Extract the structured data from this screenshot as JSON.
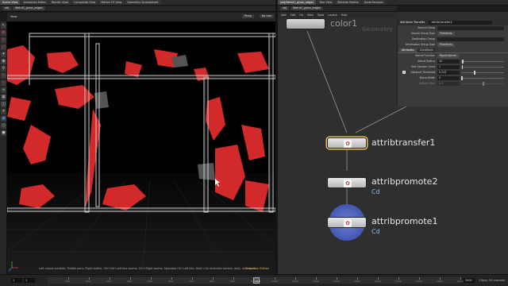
{
  "left_tabs": [
    "Scene View",
    "Animation Editor",
    "Render View",
    "Composite View",
    "Motion FX View",
    "Geometry Spreadsheet"
  ],
  "left_path": "Weird1_grass_edges",
  "right_tabs": [
    "/obj/Weird1_grass_edges",
    "Tree View",
    "Material Palette",
    "Asset Browser"
  ],
  "right_path": "Weird1_grass_edges",
  "net_menu": [
    "Add",
    "Edit",
    "Go",
    "View",
    "Tools",
    "Layout",
    "Help"
  ],
  "viewport": {
    "camera_btn": "Persp",
    "cam_btn": "No cam",
    "view_label": "View",
    "hint": "Left mouse tumbles. Middle pans. Right dollies. Ctrl+Alt+Left box zooms. Ctrl+Right zooms. Spacebar-Ctrl-Left tilts. Hold L for alternate tumble, dolly, and zoom.",
    "edition": "Education Edition"
  },
  "left_tools": [
    {
      "name": "select-tool-icon",
      "glyph": "↖",
      "color": "#e0c060"
    },
    {
      "name": "move-tool-icon",
      "glyph": "✥",
      "color": "#d04040"
    },
    {
      "name": "rotate-tool-icon",
      "glyph": "↻",
      "color": "#d04040"
    },
    {
      "name": "scale-tool-icon",
      "glyph": "⤢",
      "color": "#d04040"
    },
    {
      "name": "handle-tool-icon",
      "glyph": "✦",
      "color": "#c0c0c0"
    },
    {
      "name": "view-tool-icon",
      "glyph": "◉",
      "color": "#c0c0c0"
    },
    {
      "name": "pose-tool-icon",
      "glyph": "⚲",
      "color": "#c0c0c0"
    },
    {
      "name": "brush-tool-icon",
      "glyph": "✎",
      "color": "#d04040"
    },
    {
      "name": "magnet-tool-icon",
      "glyph": "∩",
      "color": "#d04040"
    },
    {
      "name": "snap-tool-icon",
      "glyph": "◈",
      "color": "#60a060"
    },
    {
      "name": "grid-tool-icon",
      "glyph": "▦",
      "color": "#c0c0c0"
    },
    {
      "name": "camera-tool-icon",
      "glyph": "◫",
      "color": "#c0c0c0"
    },
    {
      "name": "light-tool-icon",
      "glyph": "☀",
      "color": "#e0c060"
    },
    {
      "name": "display-tool-icon",
      "glyph": "▣",
      "color": "#6090d0"
    },
    {
      "name": "wire-tool-icon",
      "glyph": "⬡",
      "color": "#c0c0c0"
    },
    {
      "name": "shade-tool-icon",
      "glyph": "●",
      "color": "#c0c0c0"
    }
  ],
  "timeline": {
    "start": "1",
    "start2": "1",
    "current": "1012",
    "ticks": [
      "100",
      "200",
      "300",
      "400",
      "500",
      "600",
      "700",
      "800",
      "900",
      "1000",
      "1100",
      "1200",
      "1300",
      "1400",
      "1500",
      "1600",
      "1700",
      "1800",
      "1900",
      "2000"
    ],
    "end": "2000",
    "status": "3 Keys, 0/3 channels"
  },
  "network": {
    "geo_label": "Geometry",
    "top_node": "color1",
    "nodes": [
      {
        "label": "attribtransfer1",
        "sub": ""
      },
      {
        "label": "attribpromote2",
        "sub": "Cd"
      },
      {
        "label": "attribpromote1",
        "sub": "Cd"
      }
    ]
  },
  "params": {
    "type": "Attribute Transfer",
    "name": "attribtransfer1",
    "rows": [
      {
        "label": "Source Group",
        "kind": "field",
        "value": ""
      },
      {
        "label": "Source Group Type",
        "kind": "button",
        "value": "Primitives"
      },
      {
        "label": "Destination Group",
        "kind": "field",
        "value": ""
      },
      {
        "label": "Destination Group Type",
        "kind": "button",
        "value": "Primitives"
      }
    ],
    "tabs": [
      "Attributes",
      "Conditions"
    ],
    "rows2": [
      {
        "label": "Kernel Function",
        "kind": "button",
        "value": "Wyvill Kernel",
        "knob": null
      },
      {
        "label": "Kernel Radius",
        "kind": "slider",
        "value": "10",
        "knob": 0.02
      },
      {
        "label": "Max Sample Count",
        "kind": "slider",
        "value": "1",
        "knob": 0.01
      },
      {
        "label": "Distance Threshold",
        "kind": "slider",
        "value": "0.313",
        "knob": 0.3
      },
      {
        "label": "Blend Width",
        "kind": "slider",
        "value": "0",
        "knob": 0
      },
      {
        "label": "Uniform Bias",
        "kind": "slider",
        "value": "0.5",
        "knob": 0.5
      }
    ]
  }
}
